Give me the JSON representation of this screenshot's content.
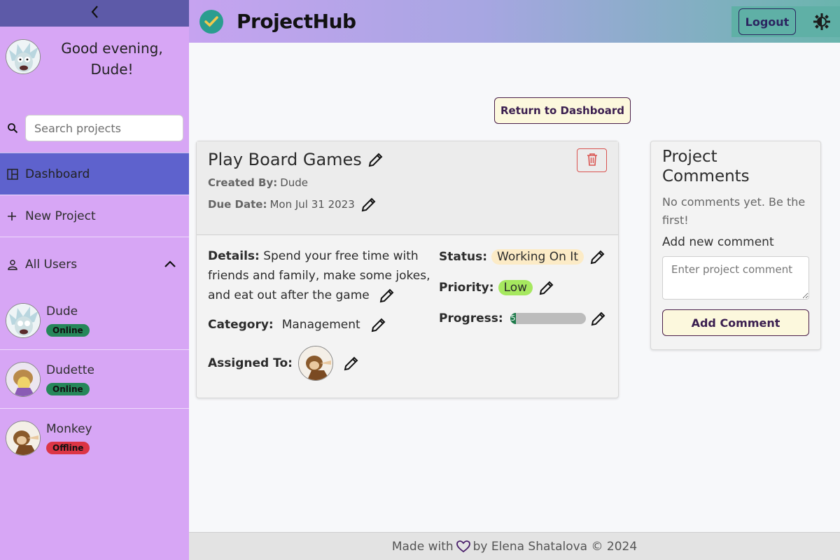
{
  "sidebar": {
    "greeting": "Good evening, Dude!",
    "search": {
      "placeholder": "Search projects",
      "value": ""
    },
    "nav": [
      {
        "label": "Dashboard",
        "icon": "dashboard-icon",
        "active": true
      },
      {
        "label": "New Project",
        "icon": "plus-icon",
        "active": false
      }
    ],
    "users_section": {
      "label": "All Users",
      "users": [
        {
          "name": "Dude",
          "status": "Online"
        },
        {
          "name": "Dudette",
          "status": "Online"
        },
        {
          "name": "Monkey",
          "status": "Offline"
        }
      ]
    }
  },
  "header": {
    "brand": "ProjectHub",
    "logout_label": "Logout",
    "colors": {
      "logo": "#2a9d8f",
      "check": "#f2c94c"
    }
  },
  "main": {
    "return_label": "Return to Dashboard",
    "project": {
      "title": "Play Board Games",
      "created_by_label": "Created By:",
      "created_by": "Dude",
      "due_date_label": "Due Date:",
      "due_date": "Mon Jul 31 2023",
      "details_label": "Details:",
      "details": "Spend your free time with friends and family, make some jokes, and eat out after the game",
      "category_label": "Category:",
      "category": "Management",
      "assigned_label": "Assigned To:",
      "status_label": "Status:",
      "status": "Working On It",
      "priority_label": "Priority:",
      "priority": "Low",
      "progress_label": "Progress:",
      "progress_value": "5",
      "progress_percent": 5
    },
    "comments": {
      "title": "Project Comments",
      "empty_text": "No comments yet. Be the first!",
      "add_label": "Add new comment",
      "input_placeholder": "Enter project comment",
      "add_button": "Add Comment"
    }
  },
  "footer": {
    "made_with": "Made with",
    "by_text": "by Elena Shatalova © 2024"
  }
}
